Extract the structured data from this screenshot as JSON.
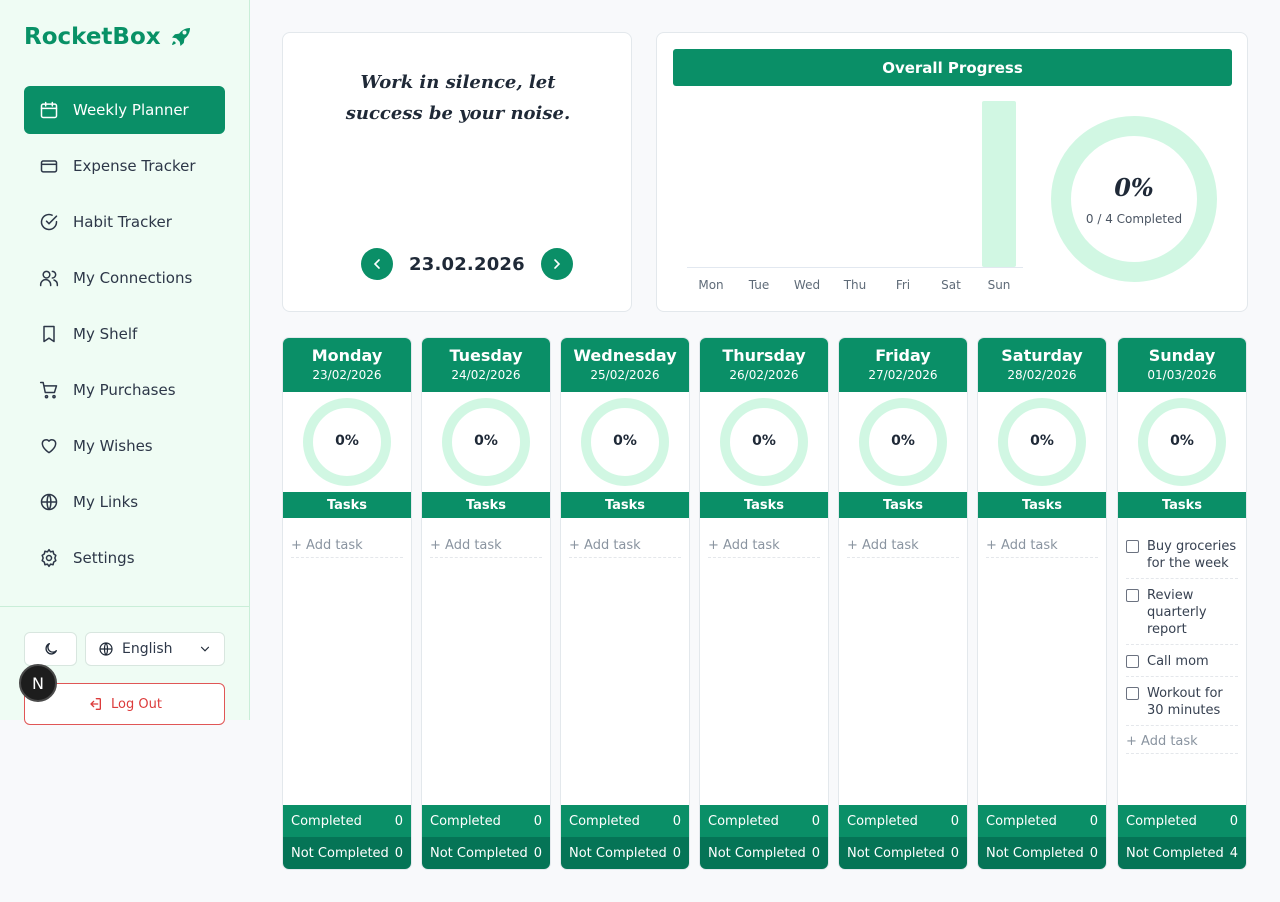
{
  "app": {
    "name": "RocketBox"
  },
  "sidebar": {
    "items": [
      {
        "label": "Weekly Planner",
        "icon": "calendar-icon",
        "active": true
      },
      {
        "label": "Expense Tracker",
        "icon": "credit-card-icon"
      },
      {
        "label": "Habit Tracker",
        "icon": "check-circle-icon"
      },
      {
        "label": "My Connections",
        "icon": "users-icon"
      },
      {
        "label": "My Shelf",
        "icon": "bookmark-icon"
      },
      {
        "label": "My Purchases",
        "icon": "cart-icon"
      },
      {
        "label": "My Wishes",
        "icon": "heart-icon"
      },
      {
        "label": "My Links",
        "icon": "globe-icon"
      },
      {
        "label": "Settings",
        "icon": "gear-icon"
      }
    ],
    "language": "English",
    "logout_label": "Log Out",
    "badge_letter": "N"
  },
  "quote": {
    "text": "Work in silence, let success be your noise."
  },
  "date_nav": {
    "date": "23.02.2026"
  },
  "overall": {
    "title": "Overall Progress",
    "percent": "0%",
    "completed_text": "0 / 4 Completed",
    "progress_fraction": 0
  },
  "chart_data": {
    "type": "bar",
    "categories": [
      "Mon",
      "Tue",
      "Wed",
      "Thu",
      "Fri",
      "Sat",
      "Sun"
    ],
    "values": [
      0,
      0,
      0,
      0,
      0,
      0,
      4
    ],
    "ylim": [
      0,
      4
    ],
    "grid": false,
    "colors": {
      "bar": "#d1f7e3"
    }
  },
  "labels": {
    "tasks": "Tasks",
    "add_task": "+ Add task",
    "completed": "Completed",
    "not_completed": "Not Completed"
  },
  "days": [
    {
      "name": "Monday",
      "date": "23/02/2026",
      "percent": "0%",
      "completed": "0",
      "not_completed": "0",
      "tasks": []
    },
    {
      "name": "Tuesday",
      "date": "24/02/2026",
      "percent": "0%",
      "completed": "0",
      "not_completed": "0",
      "tasks": []
    },
    {
      "name": "Wednesday",
      "date": "25/02/2026",
      "percent": "0%",
      "completed": "0",
      "not_completed": "0",
      "tasks": []
    },
    {
      "name": "Thursday",
      "date": "26/02/2026",
      "percent": "0%",
      "completed": "0",
      "not_completed": "0",
      "tasks": []
    },
    {
      "name": "Friday",
      "date": "27/02/2026",
      "percent": "0%",
      "completed": "0",
      "not_completed": "0",
      "tasks": []
    },
    {
      "name": "Saturday",
      "date": "28/02/2026",
      "percent": "0%",
      "completed": "0",
      "not_completed": "0",
      "tasks": []
    },
    {
      "name": "Sunday",
      "date": "01/03/2026",
      "percent": "0%",
      "completed": "0",
      "not_completed": "4",
      "tasks": [
        "Buy groceries for the week",
        "Review quarterly report",
        "Call mom",
        "Workout for 30 minutes"
      ]
    }
  ],
  "colors": {
    "brand": "#0a8f67",
    "brand_dark": "#057456",
    "ring": "#d1f7e3",
    "danger": "#dc3b3b"
  }
}
